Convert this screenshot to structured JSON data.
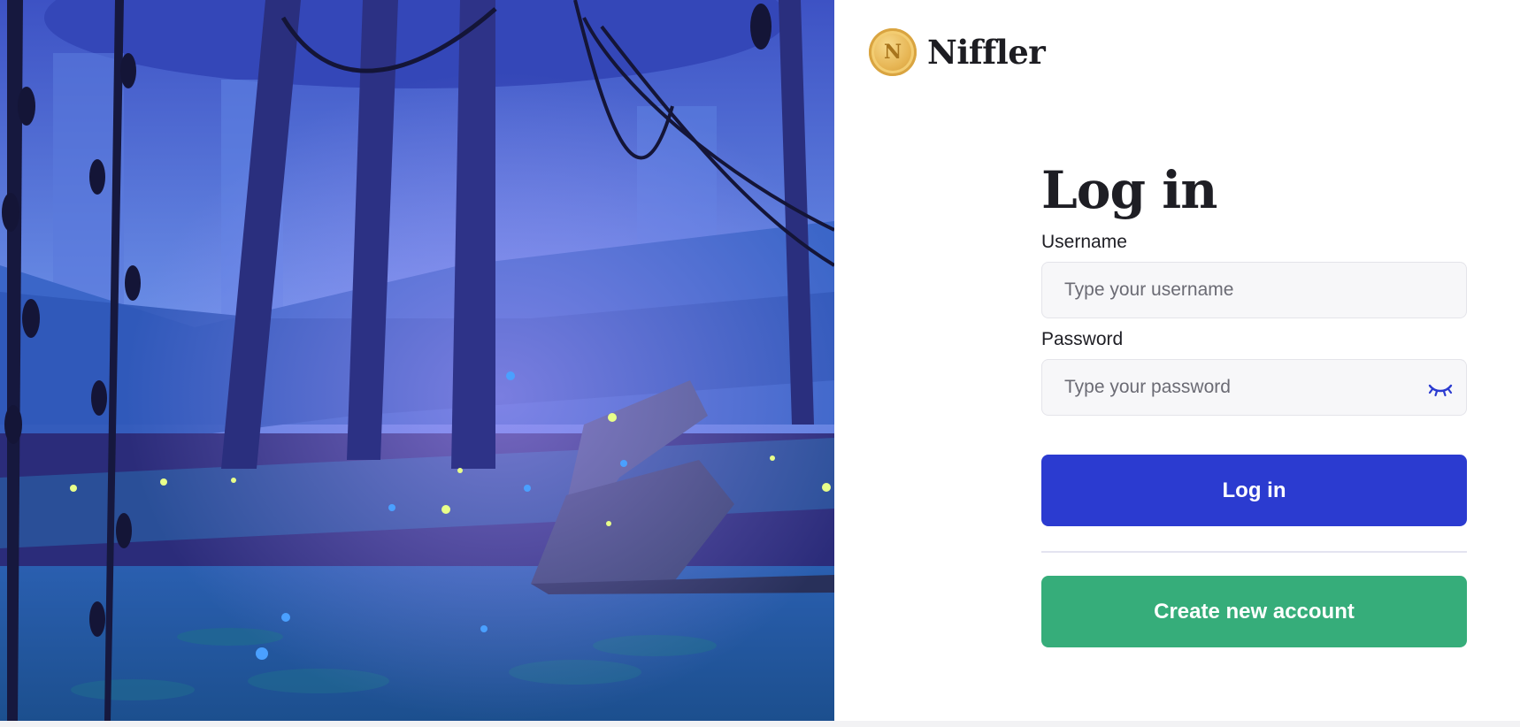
{
  "brand": {
    "name": "Niffler",
    "coin_letter": "N"
  },
  "form": {
    "title": "Log in",
    "username_label": "Username",
    "username_placeholder": "Type your username",
    "password_label": "Password",
    "password_placeholder": "Type your password",
    "login_button": "Log in",
    "create_account_button": "Create new account"
  },
  "icons": {
    "password_toggle": "eye-closed-icon",
    "logo": "coin-icon"
  },
  "colors": {
    "primary": "#2b3bd0",
    "secondary": "#36ad7a",
    "coin": "#e6b452"
  }
}
